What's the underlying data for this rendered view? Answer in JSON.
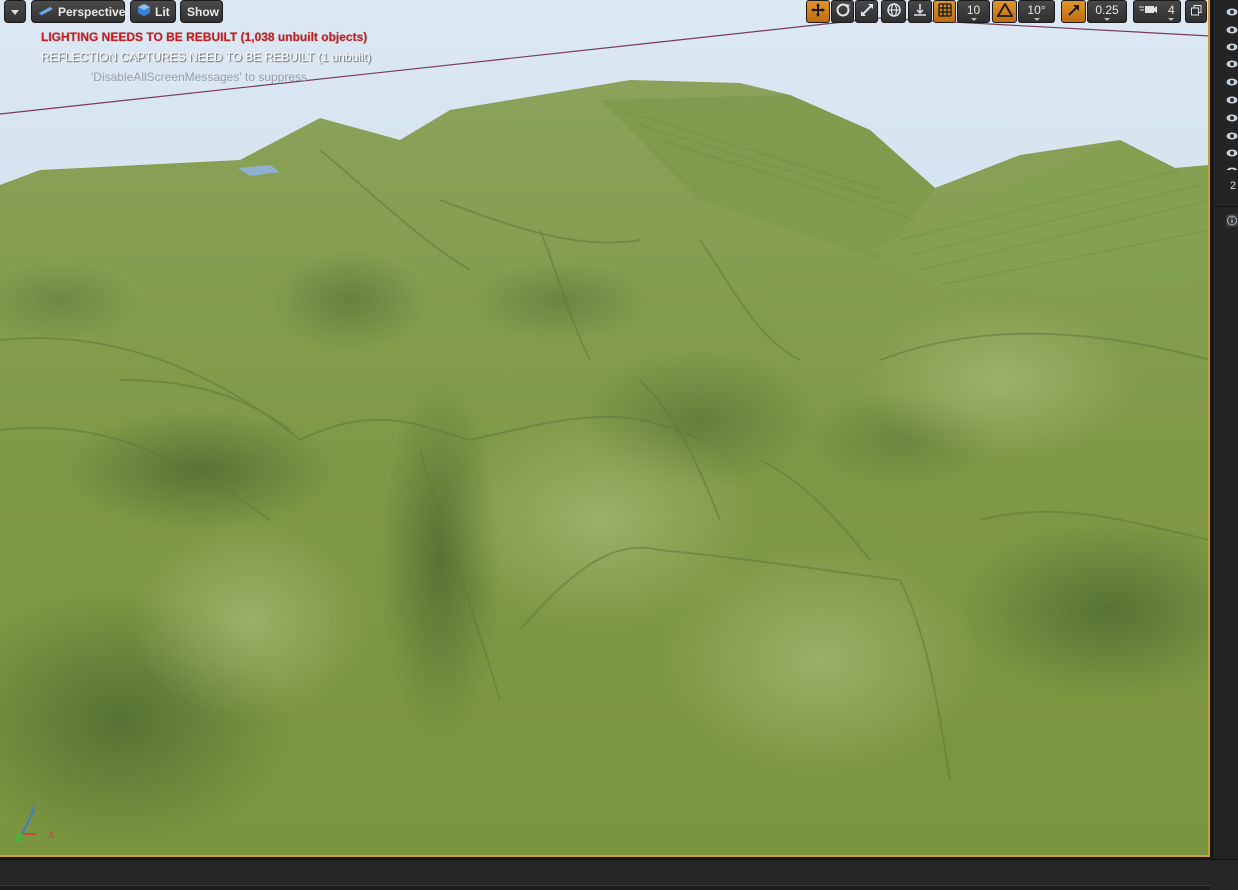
{
  "toolbar": {
    "left": {
      "dropdown_icon": "chevron-down-icon",
      "perspective_label": "Perspective",
      "lit_label": "Lit",
      "show_label": "Show"
    },
    "right": {
      "grid_snap_value": "10",
      "rotation_snap_value": "10°",
      "scale_snap_value": "0.25",
      "camera_speed_value": "4"
    }
  },
  "messages": {
    "lighting": "LIGHTING NEEDS TO BE REBUILT (1,038 unbuilt objects)",
    "reflection": "REFLECTION CAPTURES NEED TO BE REBUILT (1 unbuilt)",
    "suppress_hint": "'DisableAllScreenMessages' to suppress"
  },
  "sidebar": {
    "number": "2"
  },
  "colors": {
    "accent_orange": "#d8821e",
    "error_red": "#d01818",
    "terrain_green": "#7f9a4a",
    "sky_blue": "#cfe0ef",
    "viewport_border": "#c8a040"
  }
}
